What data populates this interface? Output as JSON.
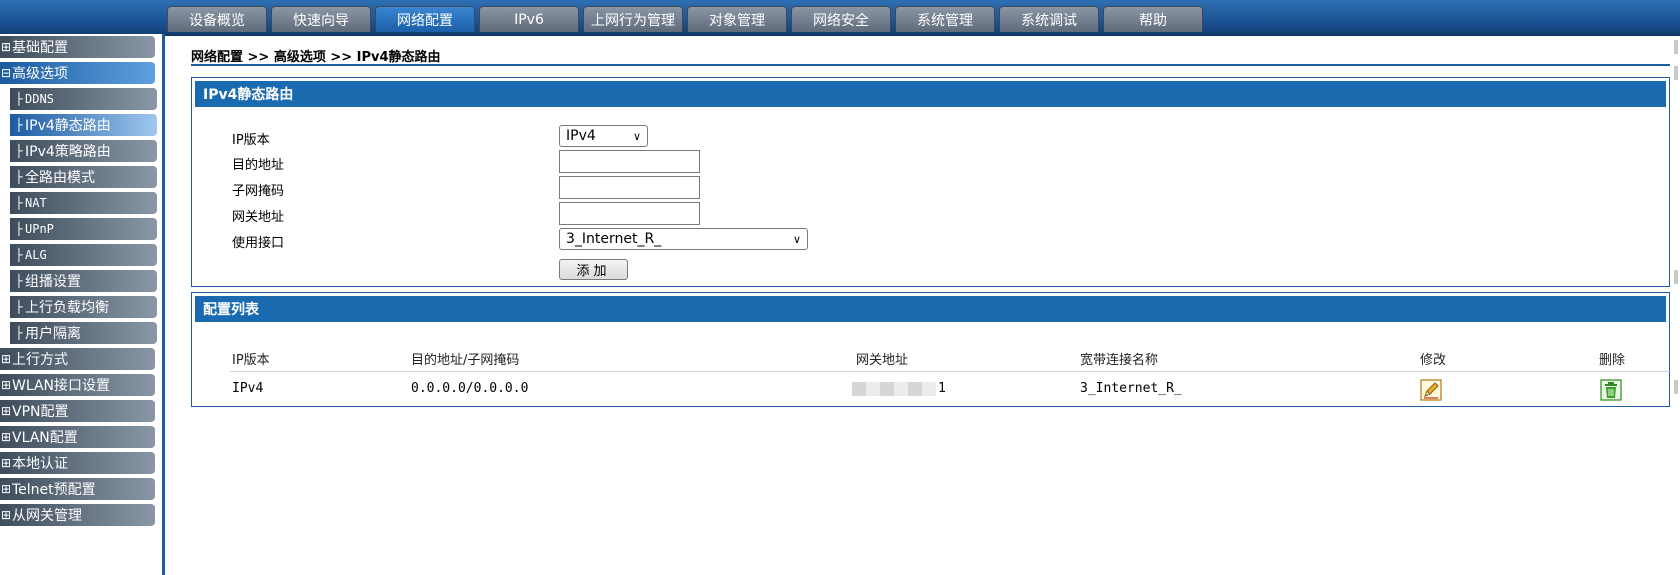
{
  "nav": {
    "tabs": [
      "设备概览",
      "快速向导",
      "网络配置",
      "IPv6",
      "上网行为管理",
      "对象管理",
      "网络安全",
      "系统管理",
      "系统调试",
      "帮助"
    ],
    "active_index": 2
  },
  "sidebar": {
    "collapsed_marker": "⊞",
    "open_marker": "⊟",
    "child_marker": "├",
    "items": [
      {
        "label": "基础配置",
        "level": 1,
        "state": "collapsed"
      },
      {
        "label": "高级选项",
        "level": 1,
        "state": "open"
      },
      {
        "label": "DDNS",
        "level": 2
      },
      {
        "label": "IPv4静态路由",
        "level": 2,
        "selected": true
      },
      {
        "label": "IPv4策略路由",
        "level": 2
      },
      {
        "label": "全路由模式",
        "level": 2
      },
      {
        "label": "NAT",
        "level": 2
      },
      {
        "label": "UPnP",
        "level": 2
      },
      {
        "label": "ALG",
        "level": 2
      },
      {
        "label": "组播设置",
        "level": 2
      },
      {
        "label": "上行负载均衡",
        "level": 2
      },
      {
        "label": "用户隔离",
        "level": 2
      },
      {
        "label": "上行方式",
        "level": 1,
        "state": "collapsed"
      },
      {
        "label": "WLAN接口设置",
        "level": 1,
        "state": "collapsed"
      },
      {
        "label": "VPN配置",
        "level": 1,
        "state": "collapsed"
      },
      {
        "label": "VLAN配置",
        "level": 1,
        "state": "collapsed"
      },
      {
        "label": "本地认证",
        "level": 1,
        "state": "collapsed"
      },
      {
        "label": "Telnet预配置",
        "level": 1,
        "state": "collapsed"
      },
      {
        "label": "从网关管理",
        "level": 1,
        "state": "collapsed"
      }
    ]
  },
  "breadcrumb": "网络配置 >> 高级选项 >> IPv4静态路由",
  "form": {
    "title": "IPv4静态路由",
    "ip_version_label": "IP版本",
    "ip_version_value": "IPv4",
    "dest_label": "目的地址",
    "dest_value": "",
    "mask_label": "子网掩码",
    "mask_value": "",
    "gateway_label": "网关地址",
    "gateway_value": "",
    "interface_label": "使用接口",
    "interface_value": "3_Internet_R_",
    "add_button": "添加"
  },
  "list": {
    "title": "配置列表",
    "columns": [
      "IP版本",
      "目的地址/子网掩码",
      "网关地址",
      "宽带连接名称",
      "修改",
      "删除"
    ],
    "rows": [
      {
        "ip_version": "IPv4",
        "dest_mask": "0.0.0.0/0.0.0.0",
        "gateway_suffix": "1",
        "connection": "3_Internet_R_"
      }
    ]
  },
  "colors": {
    "brand_blue": "#1a6ab0",
    "edit_icon": "#d9a21c",
    "delete_icon": "#2f8a1f"
  }
}
